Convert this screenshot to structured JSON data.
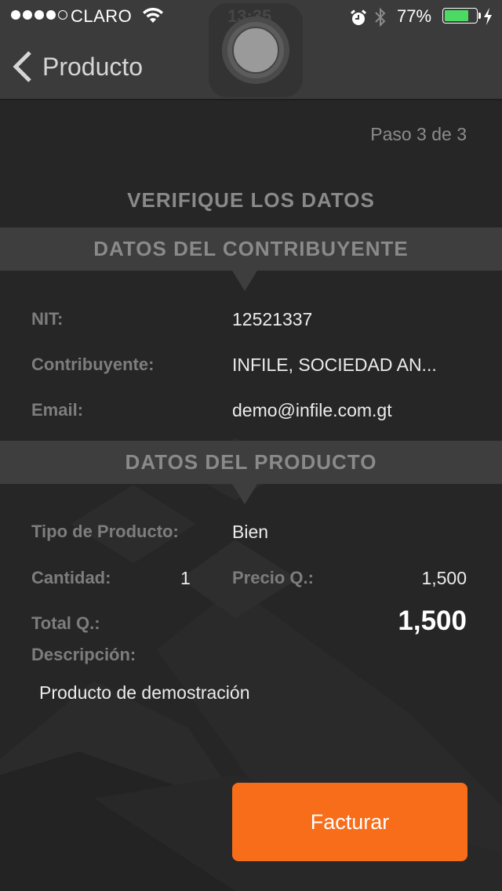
{
  "status_bar": {
    "signal_bars_filled": 4,
    "signal_bars_total": 5,
    "carrier": "CLARO",
    "time": "13:35",
    "battery_percent_label": "77%",
    "battery_level": 0.77,
    "icons": [
      "signal-dots",
      "wifi-icon",
      "alarm-icon",
      "bluetooth-icon",
      "battery-icon",
      "charging-bolt-icon"
    ]
  },
  "nav": {
    "back_label": "Producto",
    "back_icon": "chevron-left-icon"
  },
  "page": {
    "step": "Paso 3 de 3",
    "title": "VERIFIQUE LOS DATOS"
  },
  "taxpayer": {
    "section_title": "DATOS DEL CONTRIBUYENTE",
    "fields": [
      {
        "label": "NIT:",
        "value": "12521337"
      },
      {
        "label": "Contribuyente:",
        "value": "INFILE, SOCIEDAD AN..."
      },
      {
        "label": "Email:",
        "value": "demo@infile.com.gt"
      }
    ]
  },
  "product": {
    "section_title": "DATOS DEL PRODUCTO",
    "type_label": "Tipo de Producto:",
    "type_value": "Bien",
    "quantity_label": "Cantidad:",
    "quantity_value": "1",
    "price_label": "Precio Q.:",
    "price_value": "1,500",
    "total_label": "Total Q.:",
    "total_value": "1,500",
    "description_label": "Descripción:",
    "description_value": "Producto de demostración"
  },
  "actions": {
    "submit_label": "Facturar"
  },
  "colors": {
    "accent": "#f86d1a",
    "battery": "#4cd964",
    "background": "#262626",
    "band": "#3e3e3e"
  }
}
